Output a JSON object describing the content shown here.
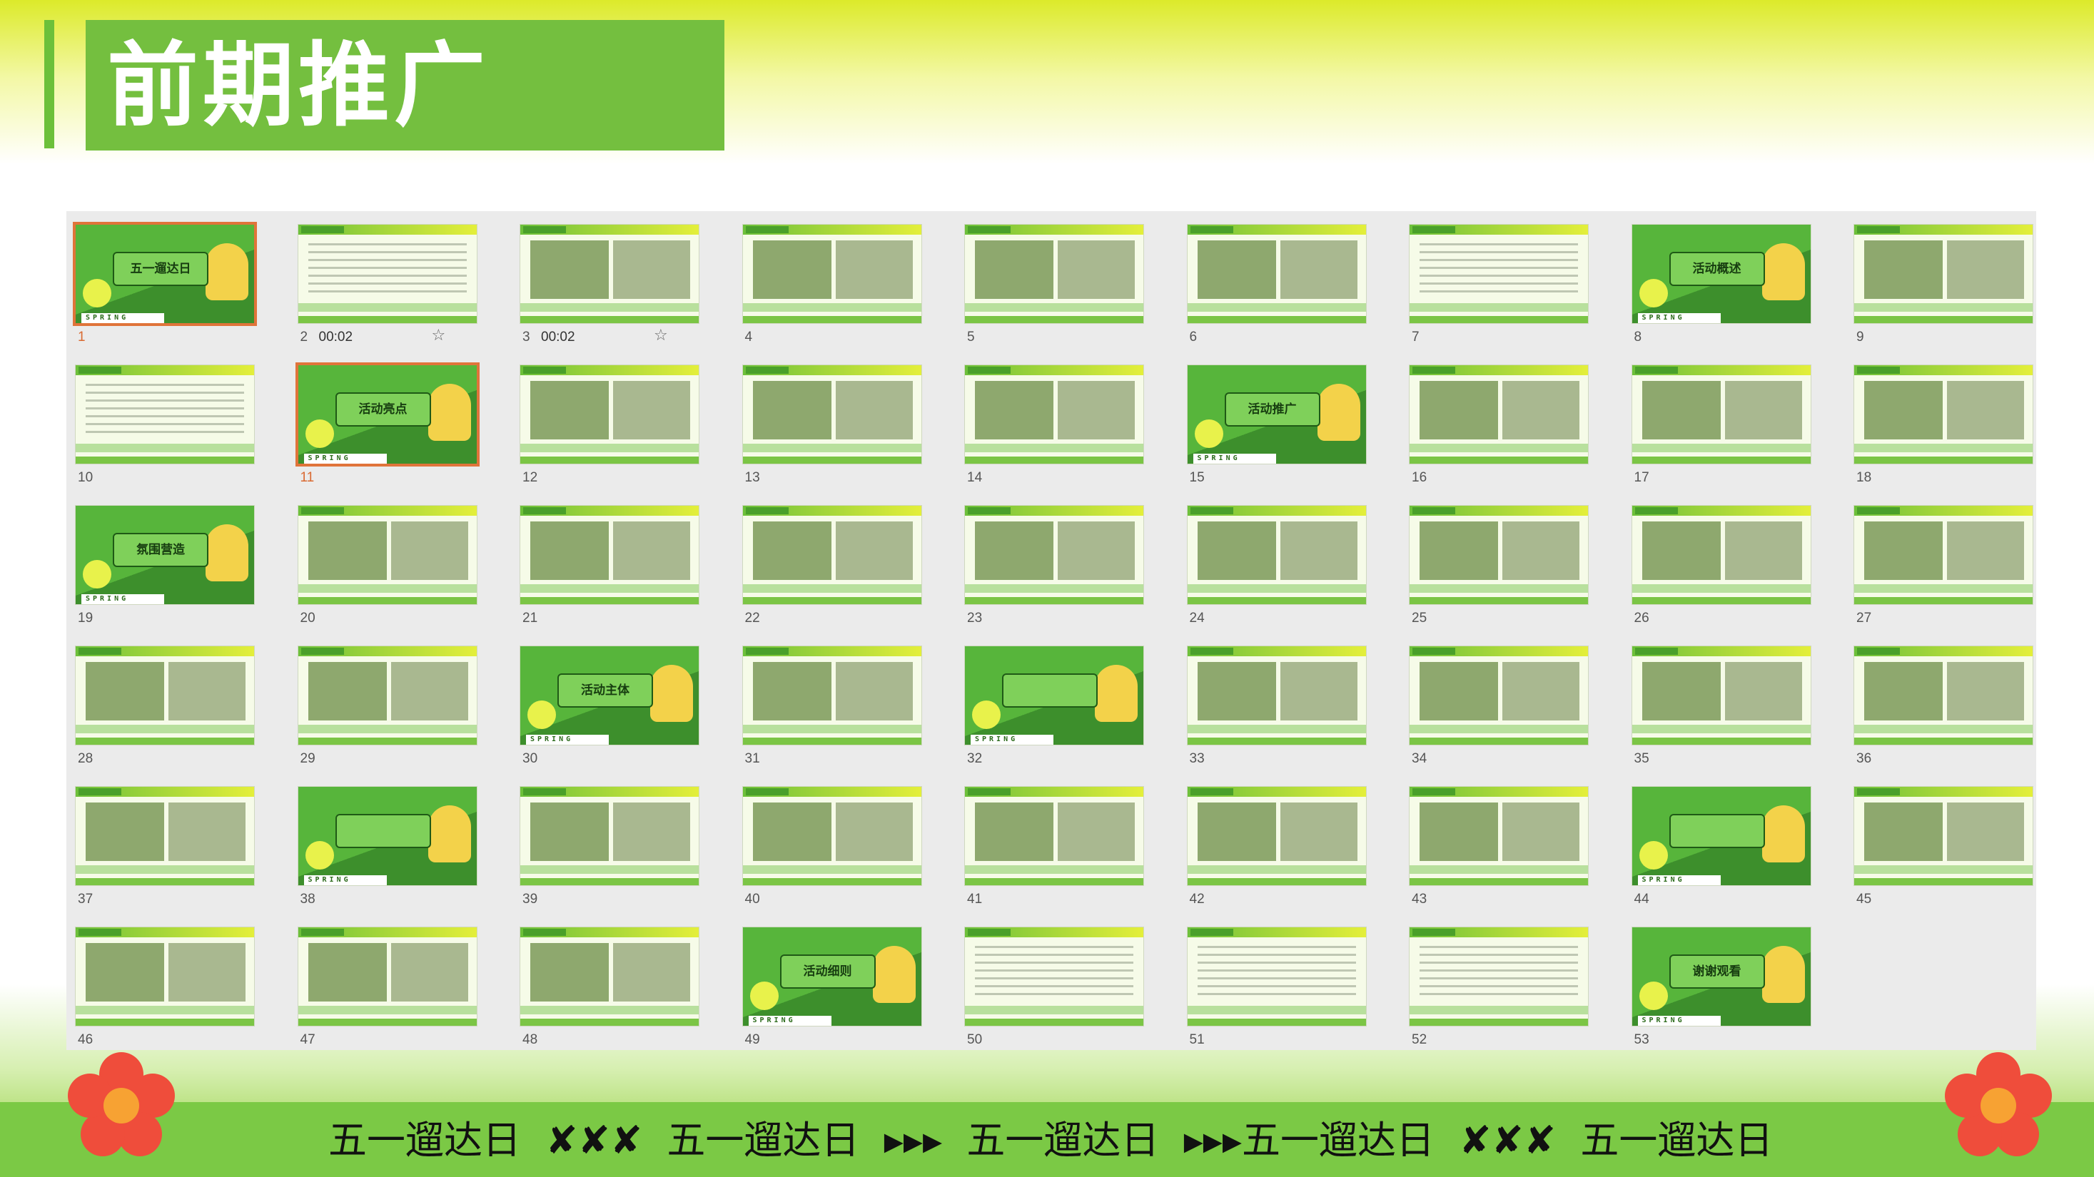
{
  "header": {
    "title": "前期推广"
  },
  "slides": [
    {
      "num": "1",
      "kind": "cover",
      "label": "五一遛达日",
      "spring": "SPRING",
      "selected": true
    },
    {
      "num": "2",
      "kind": "text",
      "duration": "00:02",
      "starred": true
    },
    {
      "num": "3",
      "kind": "photos",
      "duration": "00:02",
      "starred": true
    },
    {
      "num": "4",
      "kind": "photos"
    },
    {
      "num": "5",
      "kind": "photos"
    },
    {
      "num": "6",
      "kind": "photos"
    },
    {
      "num": "7",
      "kind": "text"
    },
    {
      "num": "8",
      "kind": "cover",
      "label": "活动概述",
      "spring": "SPRING"
    },
    {
      "num": "9",
      "kind": "photos"
    },
    {
      "num": "10",
      "kind": "text"
    },
    {
      "num": "11",
      "kind": "cover",
      "label": "活动亮点",
      "spring": "SPRING",
      "selected": true
    },
    {
      "num": "12",
      "kind": "photos"
    },
    {
      "num": "13",
      "kind": "photos"
    },
    {
      "num": "14",
      "kind": "photos"
    },
    {
      "num": "15",
      "kind": "cover",
      "label": "活动推广",
      "spring": "SPRING"
    },
    {
      "num": "16",
      "kind": "photos"
    },
    {
      "num": "17",
      "kind": "photos"
    },
    {
      "num": "18",
      "kind": "photos"
    },
    {
      "num": "19",
      "kind": "cover",
      "label": "氛围营造",
      "spring": "SPRING"
    },
    {
      "num": "20",
      "kind": "photos"
    },
    {
      "num": "21",
      "kind": "photos"
    },
    {
      "num": "22",
      "kind": "photos"
    },
    {
      "num": "23",
      "kind": "photos"
    },
    {
      "num": "24",
      "kind": "photos"
    },
    {
      "num": "25",
      "kind": "photos"
    },
    {
      "num": "26",
      "kind": "photos"
    },
    {
      "num": "27",
      "kind": "photos"
    },
    {
      "num": "28",
      "kind": "photos"
    },
    {
      "num": "29",
      "kind": "photos"
    },
    {
      "num": "30",
      "kind": "cover",
      "label": "活动主体",
      "spring": "SPRING"
    },
    {
      "num": "31",
      "kind": "photos"
    },
    {
      "num": "32",
      "kind": "cover",
      "label": "",
      "spring": "SPRING"
    },
    {
      "num": "33",
      "kind": "photos"
    },
    {
      "num": "34",
      "kind": "photos"
    },
    {
      "num": "35",
      "kind": "photos"
    },
    {
      "num": "36",
      "kind": "photos"
    },
    {
      "num": "37",
      "kind": "photos"
    },
    {
      "num": "38",
      "kind": "cover",
      "label": "",
      "spring": "SPRING"
    },
    {
      "num": "39",
      "kind": "photos"
    },
    {
      "num": "40",
      "kind": "photos"
    },
    {
      "num": "41",
      "kind": "photos"
    },
    {
      "num": "42",
      "kind": "photos"
    },
    {
      "num": "43",
      "kind": "photos"
    },
    {
      "num": "44",
      "kind": "cover",
      "label": "",
      "spring": "SPRING"
    },
    {
      "num": "45",
      "kind": "photos"
    },
    {
      "num": "46",
      "kind": "photos"
    },
    {
      "num": "47",
      "kind": "photos"
    },
    {
      "num": "48",
      "kind": "photos"
    },
    {
      "num": "49",
      "kind": "cover",
      "label": "活动细则",
      "spring": "SPRING"
    },
    {
      "num": "50",
      "kind": "text"
    },
    {
      "num": "51",
      "kind": "text"
    },
    {
      "num": "52",
      "kind": "text"
    },
    {
      "num": "53",
      "kind": "cover",
      "label": "谢谢观看",
      "spring": "SPRING"
    }
  ],
  "footer": {
    "marquee": "五一遛达日  ✘✘✘  五一遛达日  ▸▸▸  五一遛达日  ▸▸▸五一遛达日  ✘✘✘  五一遛达日"
  },
  "colors": {
    "accent": "#74bf3f",
    "selected_border": "#e0743a",
    "flower": "#ef4d3b"
  }
}
